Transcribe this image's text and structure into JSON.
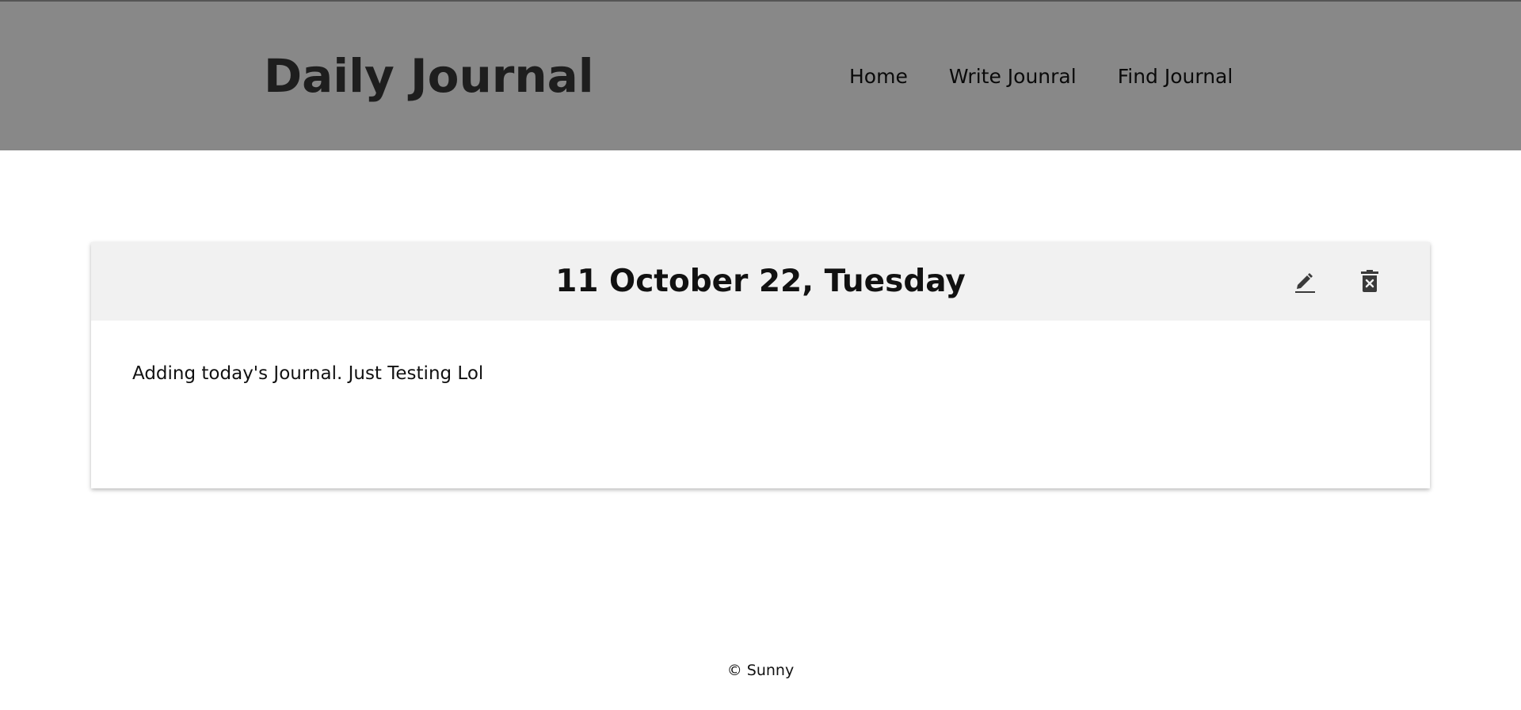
{
  "header": {
    "brand": "Daily Journal",
    "nav": [
      {
        "label": "Home"
      },
      {
        "label": "Write Jounral"
      },
      {
        "label": "Find Journal"
      }
    ],
    "background_color": "#888888"
  },
  "journal_entry": {
    "date_title": "11 October 22, Tuesday",
    "body": "Adding today's Journal. Just Testing Lol",
    "actions": [
      {
        "icon": "pencil-icon",
        "action": "edit"
      },
      {
        "icon": "trash-icon",
        "action": "delete"
      }
    ]
  },
  "footer": {
    "text": "© Sunny"
  }
}
